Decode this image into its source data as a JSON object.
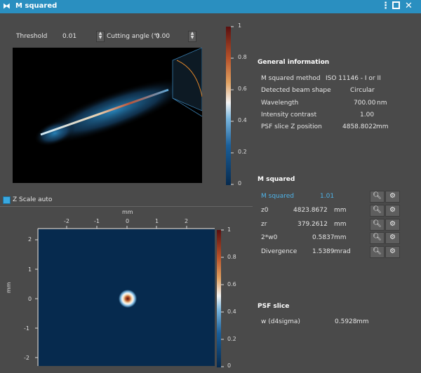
{
  "window": {
    "title": "M squared"
  },
  "controls": {
    "threshold_label": "Threshold",
    "threshold_value": "0.01",
    "cutting_angle_label": "Cutting angle (°)",
    "cutting_angle_value": "0.00"
  },
  "top_colorbar": {
    "ticks": [
      "1",
      "0.8",
      "0.6",
      "0.4",
      "0.2",
      "0"
    ]
  },
  "general_info": {
    "header": "General information",
    "rows": [
      {
        "label": "M squared method",
        "value": "ISO 11146 - I or II",
        "unit": ""
      },
      {
        "label": "Detected beam shape",
        "value": "Circular",
        "unit": ""
      },
      {
        "label": "Wavelength",
        "value": "700.00",
        "unit": "nm"
      },
      {
        "label": "Intensity contrast",
        "value": "1.00",
        "unit": ""
      },
      {
        "label": "PSF slice Z position",
        "value": "4858.8022",
        "unit": "mm"
      }
    ]
  },
  "zscale": {
    "label": "Z Scale auto"
  },
  "bottom_plot": {
    "axis_unit_x": "mm",
    "axis_unit_y": "mm",
    "x_ticks": [
      "-2",
      "-1",
      "0",
      "1",
      "2"
    ],
    "y_ticks": [
      "2",
      "1",
      "0",
      "-1",
      "-2"
    ],
    "colorbar_ticks": [
      "1",
      "0.8",
      "0.6",
      "0.4",
      "0.2",
      "0"
    ]
  },
  "m_squared": {
    "header": "M squared",
    "rows": [
      {
        "label": "M squared",
        "value": "1.01",
        "unit": ""
      },
      {
        "label": "z0",
        "value": "4823.8672",
        "unit": "mm"
      },
      {
        "label": "zr",
        "value": "379.2612",
        "unit": "mm"
      },
      {
        "label": "2*w0",
        "value": "0.5837",
        "unit": "mm"
      },
      {
        "label": "Divergence",
        "value": "1.5389",
        "unit": "mrad"
      }
    ]
  },
  "psf_slice": {
    "header": "PSF slice",
    "rows": [
      {
        "label": "w (d4sigma)",
        "value": "0.5928",
        "unit": "mm"
      }
    ]
  },
  "colors": {
    "accent": "#2a8fc0",
    "highlight": "#4fb3e8",
    "panel": "#4a4a4a"
  }
}
